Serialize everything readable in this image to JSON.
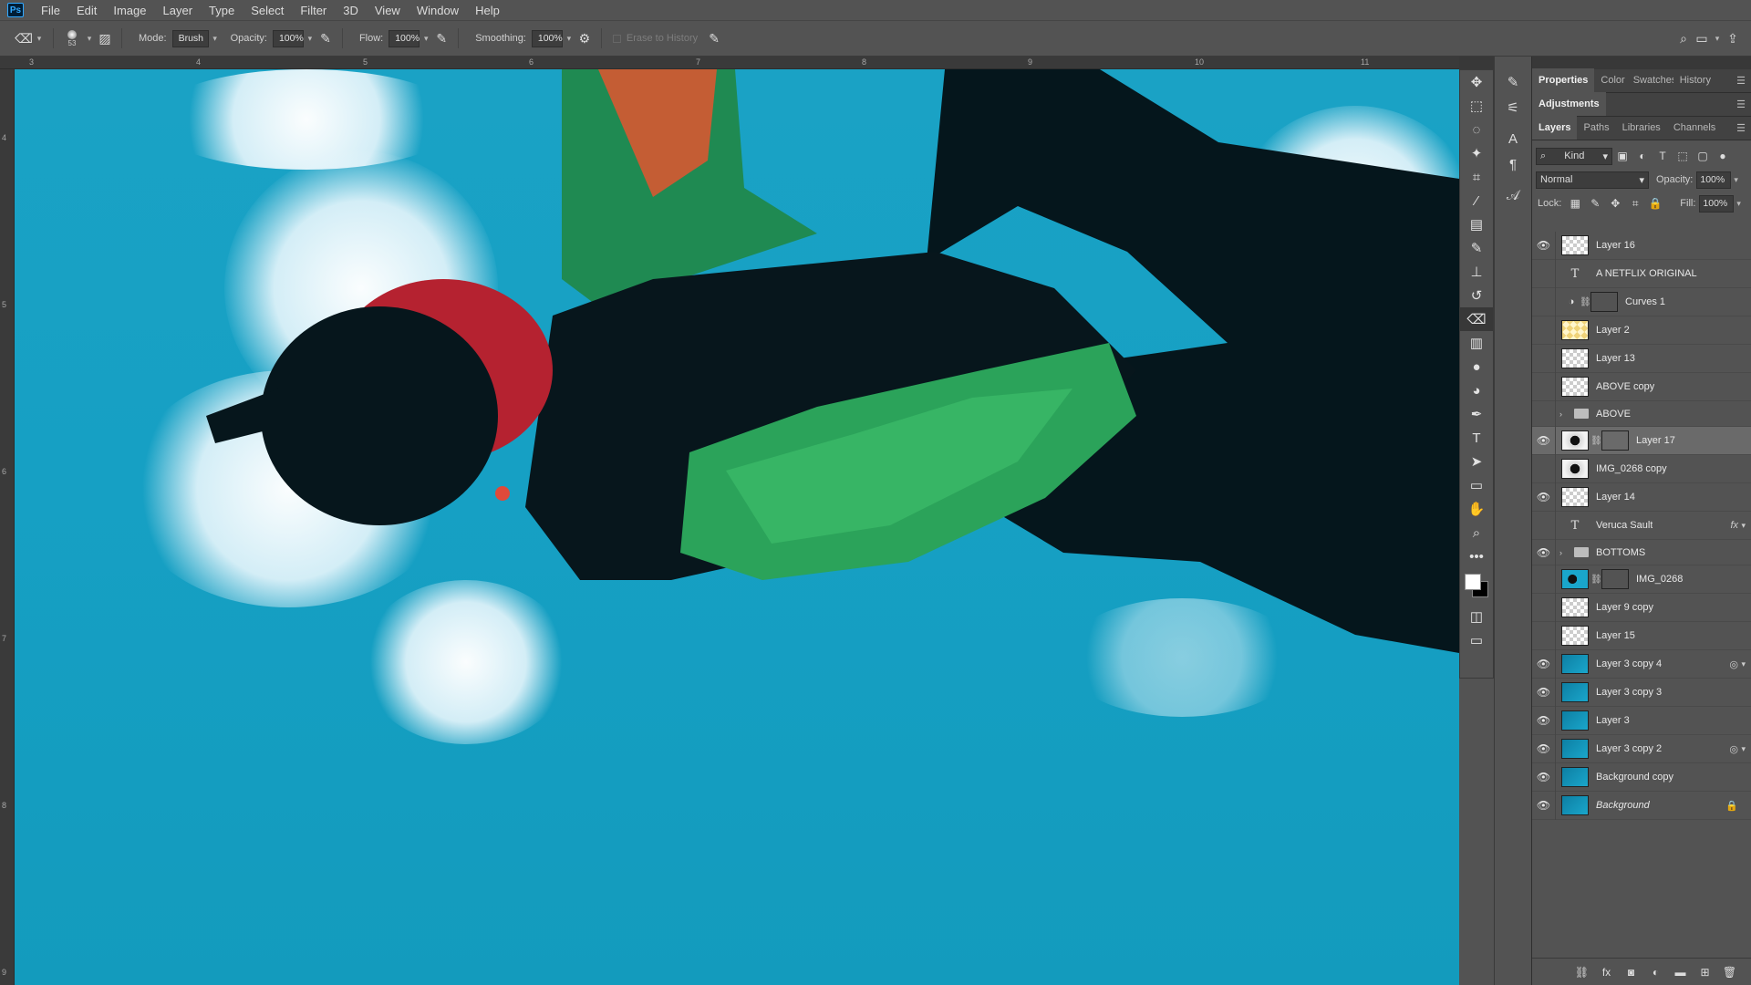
{
  "menu": [
    "File",
    "Edit",
    "Image",
    "Layer",
    "Type",
    "Select",
    "Filter",
    "3D",
    "View",
    "Window",
    "Help"
  ],
  "app_logo": "Ps",
  "options": {
    "brush_size": "53",
    "mode_label": "Mode:",
    "mode_value": "Brush",
    "opacity_label": "Opacity:",
    "opacity_value": "100%",
    "flow_label": "Flow:",
    "flow_value": "100%",
    "smoothing_label": "Smoothing:",
    "smoothing_value": "100%",
    "erase_history": "Erase to History"
  },
  "ruler": {
    "labels": [
      "3",
      "4",
      "5",
      "6",
      "7",
      "8",
      "9",
      "10",
      "11"
    ],
    "vlabels": [
      "4",
      "5",
      "6",
      "7",
      "8",
      "9"
    ]
  },
  "panels": {
    "top_tabs": [
      "Properties",
      "Color",
      "Swatches",
      "History"
    ],
    "adjust_tab": "Adjustments",
    "layer_tabs": [
      "Layers",
      "Paths",
      "Libraries",
      "Channels"
    ],
    "kind_label": "Kind",
    "blend_mode": "Normal",
    "opacity_label": "Opacity:",
    "opacity_value": "100%",
    "lock_label": "Lock:",
    "fill_label": "Fill:",
    "fill_value": "100%"
  },
  "layers": [
    {
      "name": "Layer 16",
      "visible": true,
      "thumb": "checker"
    },
    {
      "name": "A NETFLIX ORIGINAL",
      "visible": false,
      "thumb": "type"
    },
    {
      "name": "Curves 1",
      "visible": false,
      "thumb": "adjust"
    },
    {
      "name": "Layer 2",
      "visible": false,
      "thumb": "checker-y"
    },
    {
      "name": "Layer 13",
      "visible": false,
      "thumb": "checker"
    },
    {
      "name": "ABOVE copy",
      "visible": false,
      "thumb": "checker"
    },
    {
      "name": "ABOVE",
      "visible": false,
      "thumb": "group"
    },
    {
      "name": "Layer 17",
      "visible": true,
      "thumb": "photo",
      "selected": true
    },
    {
      "name": "IMG_0268 copy",
      "visible": false,
      "thumb": "photo"
    },
    {
      "name": "Layer 14",
      "visible": true,
      "thumb": "checker"
    },
    {
      "name": "Veruca Sault",
      "visible": false,
      "thumb": "type",
      "fx": "fx"
    },
    {
      "name": "BOTTOMS",
      "visible": true,
      "thumb": "group"
    },
    {
      "name": "IMG_0268",
      "visible": false,
      "thumb": "photo-blue"
    },
    {
      "name": "Layer 9 copy",
      "visible": false,
      "thumb": "checker"
    },
    {
      "name": "Layer 15",
      "visible": false,
      "thumb": "checker"
    },
    {
      "name": "Layer 3 copy 4",
      "visible": true,
      "thumb": "blue",
      "smart": true
    },
    {
      "name": "Layer 3 copy 3",
      "visible": true,
      "thumb": "blue"
    },
    {
      "name": "Layer 3",
      "visible": true,
      "thumb": "blue"
    },
    {
      "name": "Layer 3 copy 2",
      "visible": true,
      "thumb": "blue",
      "smart": true
    },
    {
      "name": "Background copy",
      "visible": true,
      "thumb": "blue"
    },
    {
      "name": "Background",
      "visible": true,
      "thumb": "blue",
      "locked": true
    }
  ]
}
